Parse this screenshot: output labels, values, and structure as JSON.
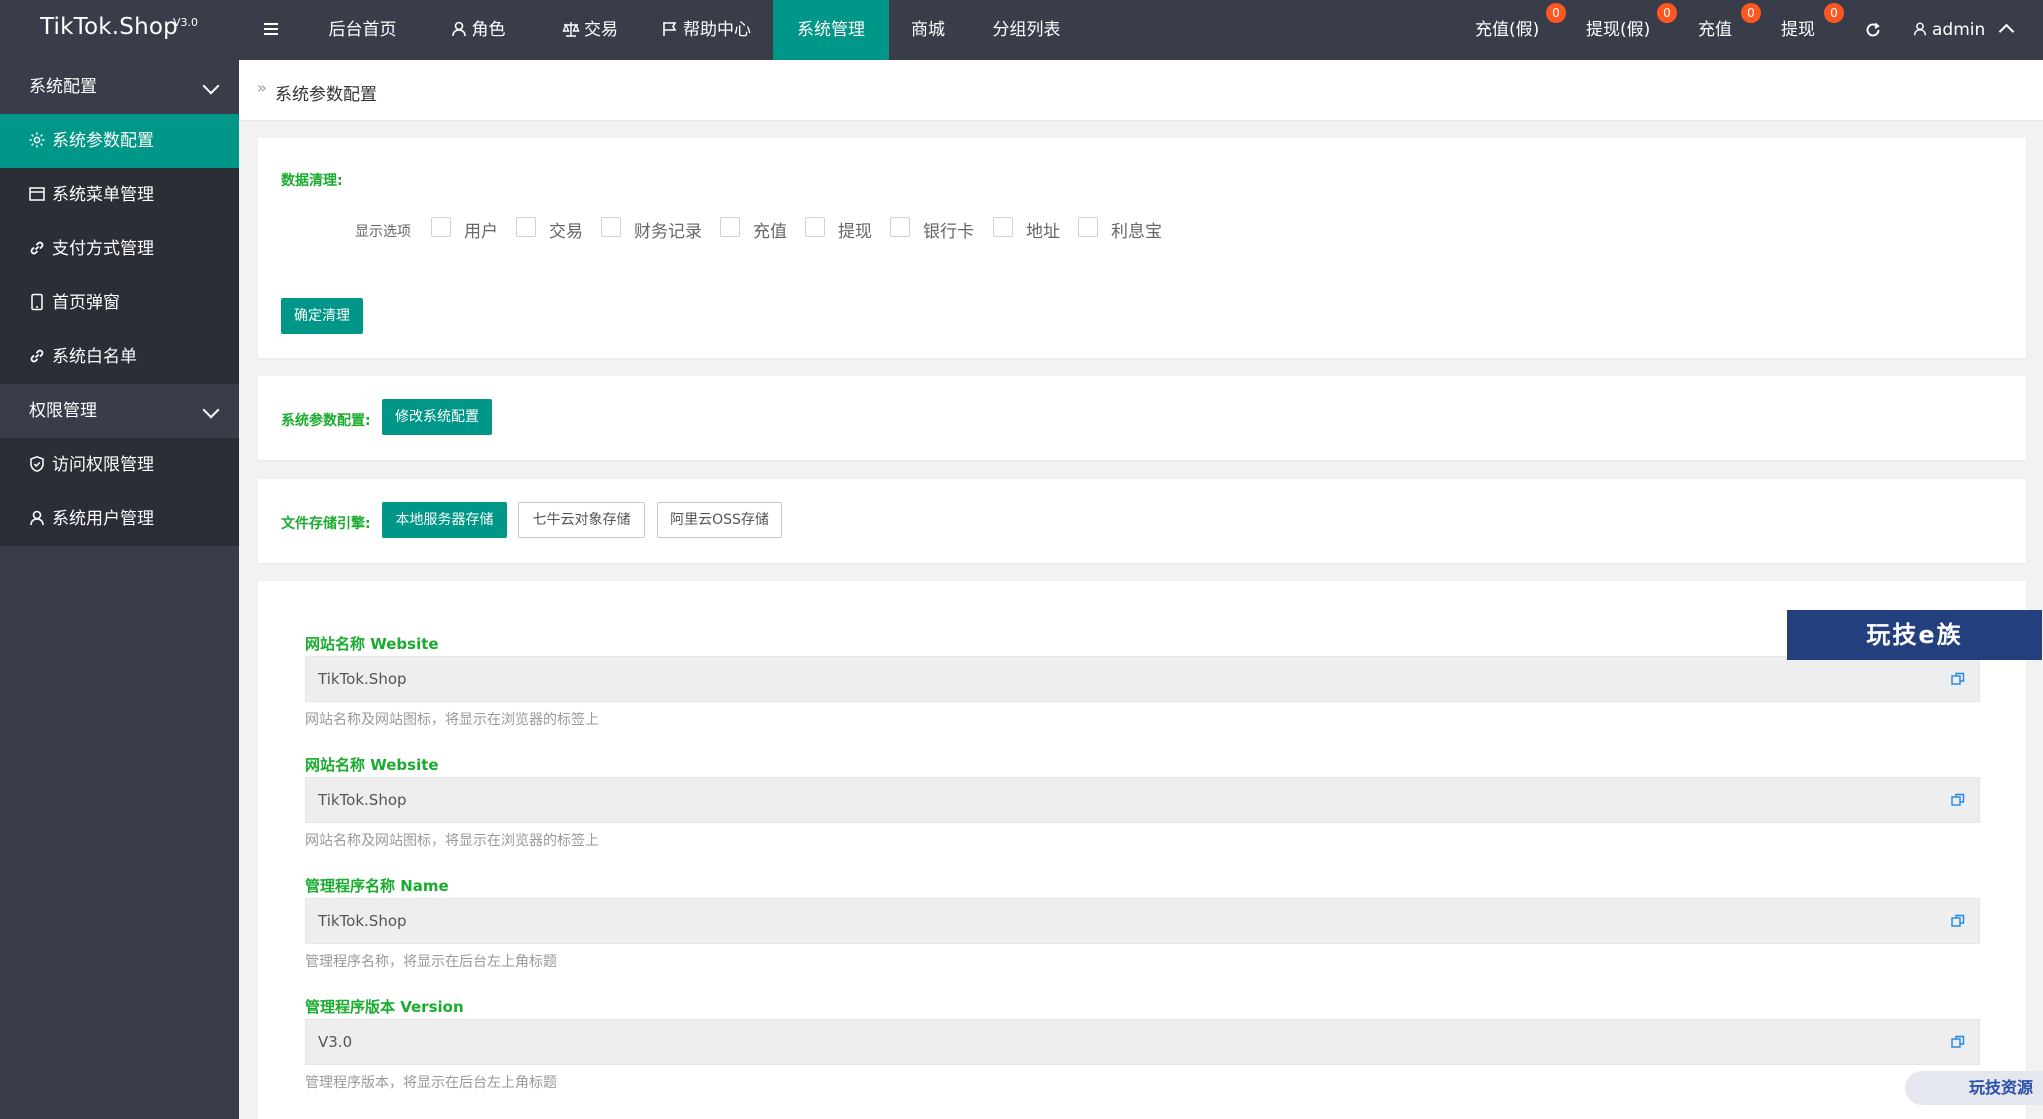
{
  "app": {
    "name": "TikTok.Shop",
    "version": "V3.0"
  },
  "nav": {
    "items": [
      {
        "label": "后台首页"
      },
      {
        "label": "角色"
      },
      {
        "label": "交易"
      },
      {
        "label": "帮助中心"
      },
      {
        "label": "系统管理"
      },
      {
        "label": "商城"
      },
      {
        "label": "分组列表"
      }
    ],
    "active": "系统管理",
    "right": [
      {
        "label": "充值(假)",
        "badge": "0"
      },
      {
        "label": "提现(假)",
        "badge": "0"
      },
      {
        "label": "充值",
        "badge": "0"
      },
      {
        "label": "提现",
        "badge": "0"
      }
    ],
    "user": "admin"
  },
  "sidebar": {
    "groups": [
      {
        "label": "系统配置",
        "items": [
          {
            "label": "系统参数配置",
            "icon": "gear-icon"
          },
          {
            "label": "系统菜单管理",
            "icon": "menu-icon"
          },
          {
            "label": "支付方式管理",
            "icon": "link-icon"
          },
          {
            "label": "首页弹窗",
            "icon": "phone-icon"
          },
          {
            "label": "系统白名单",
            "icon": "link-icon"
          }
        ]
      },
      {
        "label": "权限管理",
        "items": [
          {
            "label": "访问权限管理",
            "icon": "shield-icon"
          },
          {
            "label": "系统用户管理",
            "icon": "user-icon"
          }
        ]
      }
    ],
    "active_item": "系统参数配置"
  },
  "breadcrumb": {
    "text": "系统参数配置"
  },
  "cleanup": {
    "title": "数据清理:",
    "options_label": "显示选项",
    "options": [
      "用户",
      "交易",
      "财务记录",
      "充值",
      "提现",
      "银行卡",
      "地址",
      "利息宝"
    ],
    "confirm_label": "确定清理"
  },
  "sysconfig": {
    "title": "系统参数配置:",
    "button": "修改系统配置"
  },
  "storage": {
    "title": "文件存储引擎:",
    "options": [
      "本地服务器存储",
      "七牛云对象存储",
      "阿里云OSS存储"
    ],
    "selected": "本地服务器存储"
  },
  "fields": [
    {
      "label": "网站名称 Website",
      "value": "TikTok.Shop",
      "help": "网站名称及网站图标，将显示在浏览器的标签上"
    },
    {
      "label": "网站名称 Website",
      "value": "TikTok.Shop",
      "help": "网站名称及网站图标，将显示在浏览器的标签上"
    },
    {
      "label": "管理程序名称 Name",
      "value": "TikTok.Shop",
      "help": "管理程序名称，将显示在后台左上角标题"
    },
    {
      "label": "管理程序版本 Version",
      "value": "V3.0",
      "help": "管理程序版本，将显示在后台左上角标题"
    }
  ],
  "watermarks": {
    "top": "玩技e族",
    "bottom": "玩技资源"
  },
  "colors": {
    "topbar": "#393d49",
    "sidebar": "#393d49",
    "sidebar_sub": "#2b2e37",
    "accent": "#009688",
    "label_green": "#1aab2f",
    "badge": "#ff5722"
  }
}
